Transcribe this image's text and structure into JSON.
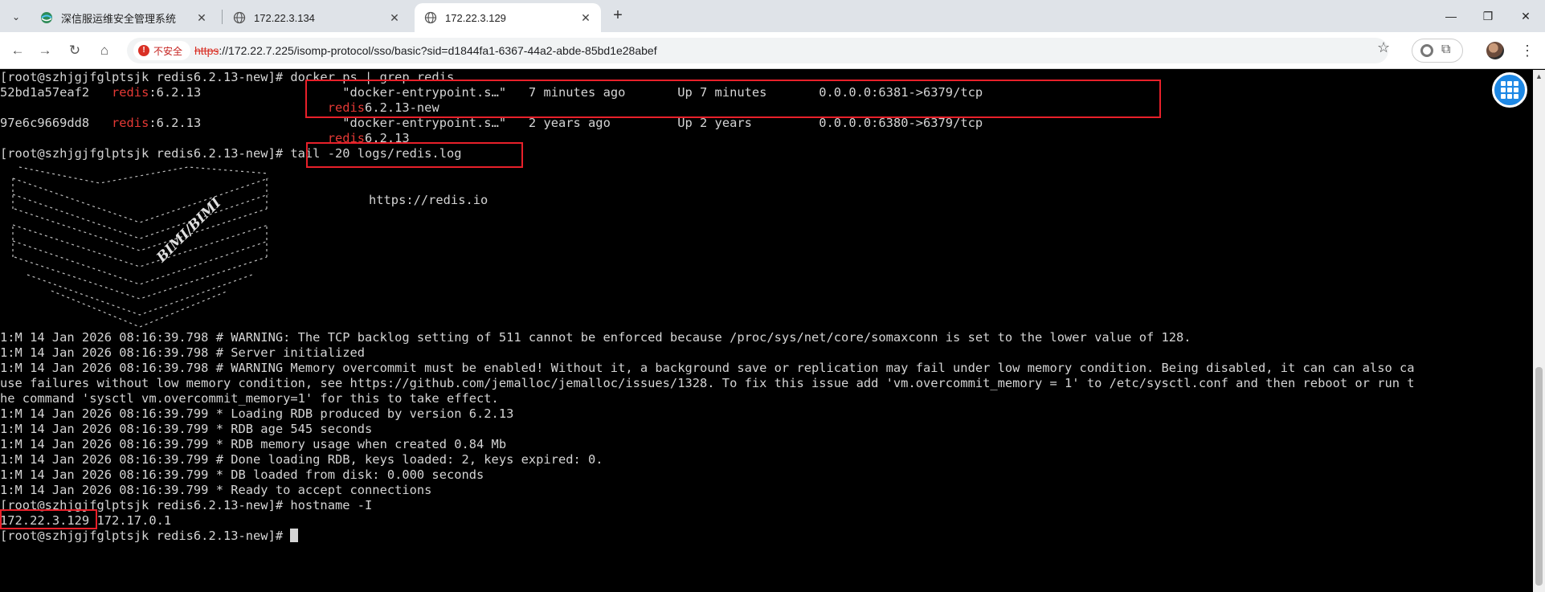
{
  "browser": {
    "tabs": [
      {
        "title": "深信服运维安全管理系统",
        "active": false
      },
      {
        "title": "172.22.3.134",
        "active": false
      },
      {
        "title": "172.22.3.129",
        "active": true
      }
    ],
    "new_tab": "+",
    "win_minimize": "—",
    "win_restore": "❐",
    "win_close": "✕",
    "security_label": "不安全",
    "url_scheme": "https",
    "url_rest": "://172.22.7.225/isomp-protocol/sso/basic?sid=d1844fa1-6367-44a2-abde-85bd1e28abef"
  },
  "terminal": {
    "lines": {
      "l1": "[root@szhjgjfglptsjk redis6.2.13-new]# docker ps | grep redis",
      "l2a": "52bd1a57eaf2   ",
      "l2b": "redis",
      "l2c": ":6.2.13                   \"docker-entrypoint.s…\"   7 minutes ago       Up 7 minutes       0.0.0.0:6381->6379/tcp",
      "l3a": "                                            ",
      "l3b": "redis",
      "l3c": "6.2.13-new",
      "l4a": "97e6c9669dd8   ",
      "l4b": "redis",
      "l4c": ":6.2.13                   \"docker-entrypoint.s…\"   2 years ago         Up 2 years         0.0.0.0:6380->6379/tcp",
      "l5a": "                                            ",
      "l5b": "redis",
      "l5c": "6.2.13",
      "l6": "[root@szhjgjfglptsjk redis6.2.13-new]# tail -20 logs/redis.log",
      "redis_url": "https://redis.io",
      "watermark": "BIMI/BIMI",
      "log1": "1:M 14 Jan 2026 08:16:39.798 # WARNING: The TCP backlog setting of 511 cannot be enforced because /proc/sys/net/core/somaxconn is set to the lower value of 128.",
      "log2": "1:M 14 Jan 2026 08:16:39.798 # Server initialized",
      "log3": "1:M 14 Jan 2026 08:16:39.798 # WARNING Memory overcommit must be enabled! Without it, a background save or replication may fail under low memory condition. Being disabled, it can can also ca",
      "log4": "use failures without low memory condition, see https://github.com/jemalloc/jemalloc/issues/1328. To fix this issue add 'vm.overcommit_memory = 1' to /etc/sysctl.conf and then reboot or run t",
      "log5": "he command 'sysctl vm.overcommit_memory=1' for this to take effect.",
      "log6": "1:M 14 Jan 2026 08:16:39.799 * Loading RDB produced by version 6.2.13",
      "log7": "1:M 14 Jan 2026 08:16:39.799 * RDB age 545 seconds",
      "log8": "1:M 14 Jan 2026 08:16:39.799 * RDB memory usage when created 0.84 Mb",
      "log9": "1:M 14 Jan 2026 08:16:39.799 # Done loading RDB, keys loaded: 2, keys expired: 0.",
      "log10": "1:M 14 Jan 2026 08:16:39.799 * DB loaded from disk: 0.000 seconds",
      "log11": "1:M 14 Jan 2026 08:16:39.799 * Ready to accept connections",
      "l7": "[root@szhjgjfglptsjk redis6.2.13-new]# hostname -I",
      "ip1": "172.22.3.129",
      "ip2": " 172.17.0.1",
      "l9": "[root@szhjgjfglptsjk redis6.2.13-new]# "
    }
  },
  "colors": {
    "highlight": "#e8202a",
    "redis_red": "#e53935",
    "terminal_bg": "#000000",
    "terminal_fg": "#d4d4d4"
  }
}
